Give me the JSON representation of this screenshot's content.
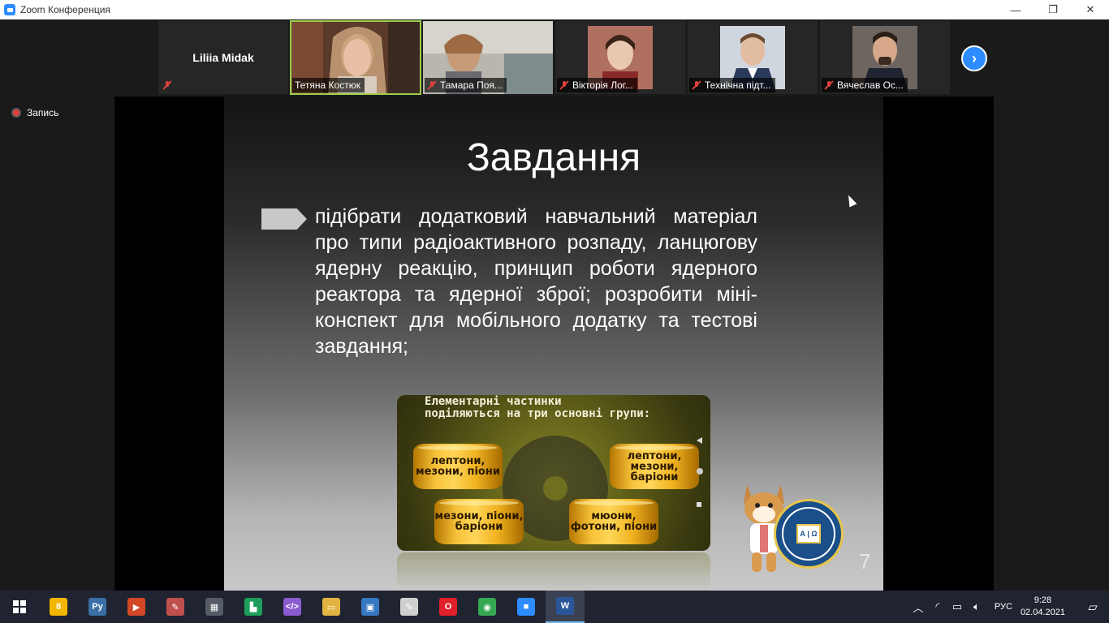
{
  "window": {
    "title": "Zoom Конференция",
    "minimize": "—",
    "restore": "❐",
    "close": "✕"
  },
  "participants": [
    {
      "name": "Liliia Midak",
      "video": false
    },
    {
      "name": "Тетяна Костюк",
      "video": true,
      "active": true
    },
    {
      "name": "Тамара Поя...",
      "video": true
    },
    {
      "name": "Вікторія Лог...",
      "video": true
    },
    {
      "name": "Технічна підт...",
      "video": true
    },
    {
      "name": "Вячеслав Ос...",
      "video": true
    }
  ],
  "next_page_icon": "chevron-right-icon",
  "recording": {
    "label": "Запись"
  },
  "slide": {
    "title": "Завдання",
    "bullet": "підібрати додатковий навчальний матеріал про типи радіоактивного розпаду, ланцюгову ядерну реакцію, принцип роботи ядерного реактора та ядерної зброї; розробити міні-конспект для мобільного додатку та тестові завдання;",
    "inner_title_line1": "Елементарні частинки",
    "inner_title_line2": "поділяються на три основні групи:",
    "barrels": [
      {
        "text": "лептони, мезони, піони"
      },
      {
        "text": "лептони, мезони, баріони"
      },
      {
        "text": "мезони, піони, баріони"
      },
      {
        "text": "мюони, фотони, піони"
      }
    ],
    "seal_text": "Α | Ω",
    "page_number": "7"
  },
  "taskbar": {
    "apps": [
      {
        "name": "sticky-app",
        "color": "#f2b600",
        "glyph": "8"
      },
      {
        "name": "python-app",
        "color": "#3a6ea5",
        "glyph": "Py"
      },
      {
        "name": "media-app",
        "color": "#d24726",
        "glyph": "▶"
      },
      {
        "name": "paint-app",
        "color": "#c0504d",
        "glyph": "✎"
      },
      {
        "name": "calculator-app",
        "color": "#555c66",
        "glyph": "▦"
      },
      {
        "name": "geogebra-app",
        "color": "#1e9e5a",
        "glyph": "▙"
      },
      {
        "name": "code-app",
        "color": "#8a5cd0",
        "glyph": "</>"
      },
      {
        "name": "explorer-app",
        "color": "#e3b341",
        "glyph": "▭"
      },
      {
        "name": "save-app",
        "color": "#3778c2",
        "glyph": "▣"
      },
      {
        "name": "editor-app",
        "color": "#d0d0d0",
        "glyph": "✎"
      },
      {
        "name": "opera-app",
        "color": "#e0202b",
        "glyph": "O"
      },
      {
        "name": "chrome-app",
        "color": "#34a853",
        "glyph": "◉"
      },
      {
        "name": "zoom-app",
        "color": "#2d8cff",
        "glyph": "■"
      },
      {
        "name": "word-app",
        "color": "#2b579a",
        "glyph": "W",
        "active": true
      }
    ],
    "tray": {
      "lang": "РУС",
      "time": "9:28",
      "date": "02.04.2021"
    }
  }
}
